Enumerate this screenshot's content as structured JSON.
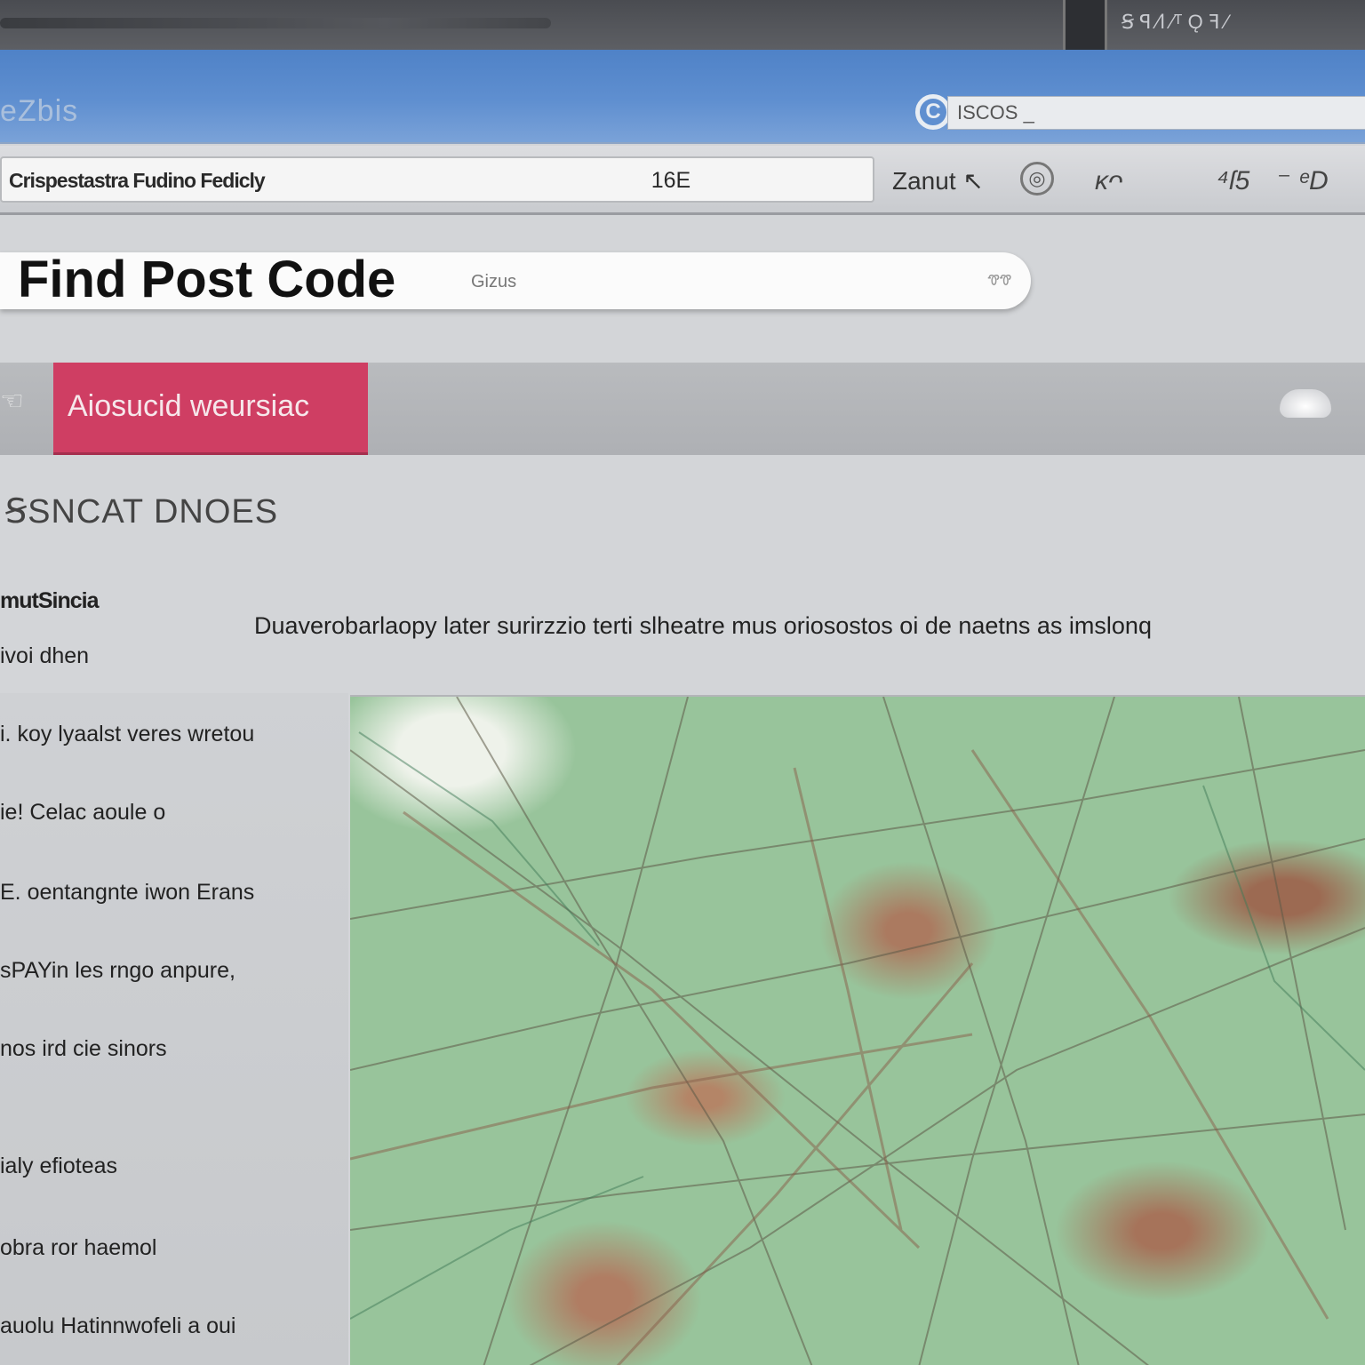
{
  "window": {
    "title_right_text": "Ꞩ  ꟼ  ⁄ⅼ ⁄ᵀ   Ǫ ꟻ ⁄"
  },
  "header": {
    "app_title": "eZbis",
    "url_value": "ISCOS _"
  },
  "toolbar": {
    "info_text": "Crispestastra Fudino Fedicly",
    "info_count": "16E",
    "label": "Zanut ↖",
    "item_2": "ᴋᴖ",
    "item_3": "⁴ſ5ᷮ ⁻ ᵉD"
  },
  "page": {
    "title": "Find Post Code",
    "search_placeholder": "Gizus",
    "search_hint": "ᏡᏡ"
  },
  "nav": {
    "active_tab": "Aiosucid weursiac"
  },
  "content": {
    "section_heading": "ꞨSNCAT DNOES",
    "description": "Duaverobarlaopy later surirzzio terti slheatre mus oriosostos oi de naetns as imslonq"
  },
  "sidebar": {
    "items": [
      {
        "label": "mutSincia",
        "bold": true
      },
      {
        "label": "ivoi dhen"
      },
      {
        "label": "i. koy lyaalst veres wretou"
      },
      {
        "label": "ie! Celac aoule o"
      },
      {
        "label": "E. oentangnte iwon Erans"
      },
      {
        "label": "sPAYin les rngo anpure,"
      },
      {
        "label": "nos ird cie sinors"
      },
      {
        "label": "ialy efioteas"
      },
      {
        "label": "obra ror haemol"
      },
      {
        "label": "auolu Hatinnwofeli a oui"
      }
    ]
  },
  "colors": {
    "header_blue": "#5f8fd0",
    "active_tab": "#cf3e63",
    "map_green": "#98c49b",
    "map_brown": "#a6735a"
  },
  "icons": {
    "browser": "browser-icon",
    "toolbar": "settings-icon",
    "nav_left": "hand-icon",
    "nav_right": "cloud-icon"
  }
}
